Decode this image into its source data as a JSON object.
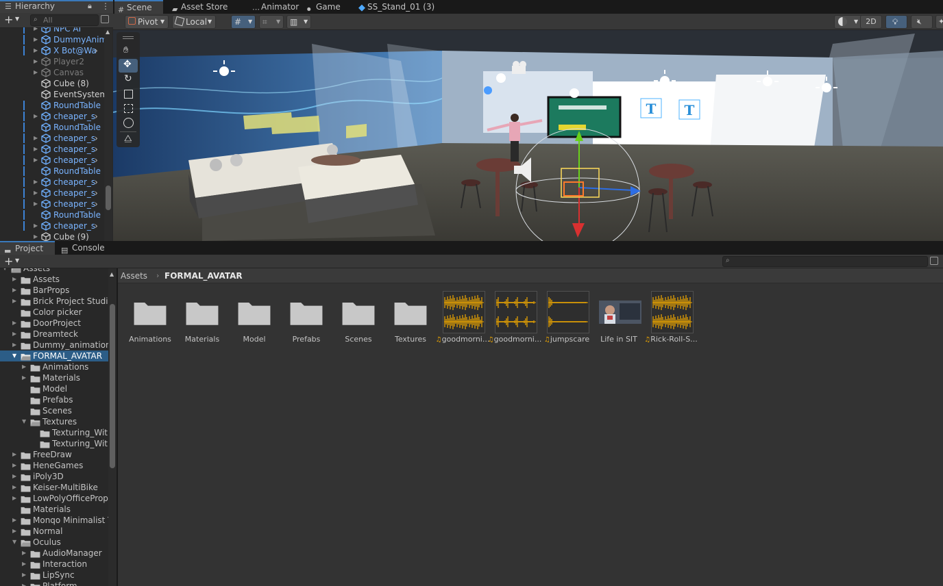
{
  "hierarchy": {
    "tab_label": "Hierarchy",
    "search_placeholder": "All",
    "rows": [
      {
        "name": "NPC AI",
        "color": "blue",
        "arrow": true,
        "more": false,
        "prefab": true
      },
      {
        "name": "DummyAnim",
        "color": "blue",
        "arrow": true,
        "more": false,
        "prefab": true
      },
      {
        "name": "X Bot@Wa",
        "color": "blue",
        "arrow": true,
        "more": true,
        "prefab": true
      },
      {
        "name": "Player2",
        "color": "grey",
        "arrow": true,
        "more": false,
        "prefab": false
      },
      {
        "name": "Canvas",
        "color": "grey",
        "arrow": true,
        "more": false,
        "prefab": false
      },
      {
        "name": "Cube (8)",
        "color": "white",
        "arrow": false,
        "more": false,
        "prefab": false
      },
      {
        "name": "EventSystem",
        "color": "white",
        "arrow": false,
        "more": false,
        "prefab": false
      },
      {
        "name": "RoundTable",
        "color": "blue",
        "arrow": false,
        "more": false,
        "prefab": true
      },
      {
        "name": "cheaper_s",
        "color": "blue",
        "arrow": true,
        "more": true,
        "prefab": true
      },
      {
        "name": "RoundTable",
        "color": "blue",
        "arrow": false,
        "more": false,
        "prefab": true
      },
      {
        "name": "cheaper_s",
        "color": "blue",
        "arrow": true,
        "more": true,
        "prefab": true
      },
      {
        "name": "cheaper_s",
        "color": "blue",
        "arrow": true,
        "more": true,
        "prefab": true
      },
      {
        "name": "cheaper_s",
        "color": "blue",
        "arrow": true,
        "more": true,
        "prefab": true
      },
      {
        "name": "RoundTable",
        "color": "blue",
        "arrow": false,
        "more": false,
        "prefab": true
      },
      {
        "name": "cheaper_s",
        "color": "blue",
        "arrow": true,
        "more": true,
        "prefab": true
      },
      {
        "name": "cheaper_s",
        "color": "blue",
        "arrow": true,
        "more": true,
        "prefab": true
      },
      {
        "name": "cheaper_s",
        "color": "blue",
        "arrow": true,
        "more": true,
        "prefab": true
      },
      {
        "name": "RoundTable",
        "color": "blue",
        "arrow": false,
        "more": false,
        "prefab": true
      },
      {
        "name": "cheaper_s",
        "color": "blue",
        "arrow": true,
        "more": true,
        "prefab": true
      },
      {
        "name": "Cube (9)",
        "color": "white",
        "arrow": true,
        "more": false,
        "prefab": false
      }
    ]
  },
  "top_tabs": [
    {
      "label": "Scene",
      "icon": "grid-icon",
      "active": true
    },
    {
      "label": "Asset Store",
      "icon": "shopping-bag-icon",
      "active": false
    },
    {
      "label": "Animator",
      "icon": "animator-icon",
      "active": false
    },
    {
      "label": "Game",
      "icon": "gamepad-icon",
      "active": false
    },
    {
      "label": "SS_Stand_01 (3)",
      "icon": "prefab-cube-icon",
      "active": false
    }
  ],
  "scene_toolbar": {
    "pivot_label": "Pivot",
    "local_label": "Local",
    "mode_2d_label": "2D"
  },
  "project": {
    "tabs": [
      {
        "label": "Project",
        "icon": "folder-icon",
        "active": true
      },
      {
        "label": "Console",
        "icon": "console-icon",
        "active": false
      }
    ],
    "tree": [
      {
        "name": "Assets",
        "level": 0,
        "expanded": true,
        "arrow": true,
        "selected": false
      },
      {
        "name": "Assets",
        "level": 1,
        "expanded": false,
        "arrow": true,
        "selected": false
      },
      {
        "name": "BarProps",
        "level": 1,
        "expanded": false,
        "arrow": true,
        "selected": false
      },
      {
        "name": "Brick Project Studio",
        "level": 1,
        "expanded": false,
        "arrow": true,
        "selected": false
      },
      {
        "name": "Color picker",
        "level": 1,
        "expanded": false,
        "arrow": false,
        "selected": false
      },
      {
        "name": "DoorProject",
        "level": 1,
        "expanded": false,
        "arrow": true,
        "selected": false
      },
      {
        "name": "Dreamteck",
        "level": 1,
        "expanded": false,
        "arrow": true,
        "selected": false
      },
      {
        "name": "Dummy_animation",
        "level": 1,
        "expanded": false,
        "arrow": true,
        "selected": false
      },
      {
        "name": "FORMAL_AVATAR",
        "level": 1,
        "expanded": true,
        "arrow": true,
        "selected": true
      },
      {
        "name": "Animations",
        "level": 2,
        "expanded": false,
        "arrow": true,
        "selected": false
      },
      {
        "name": "Materials",
        "level": 2,
        "expanded": false,
        "arrow": true,
        "selected": false
      },
      {
        "name": "Model",
        "level": 2,
        "expanded": false,
        "arrow": false,
        "selected": false
      },
      {
        "name": "Prefabs",
        "level": 2,
        "expanded": false,
        "arrow": false,
        "selected": false
      },
      {
        "name": "Scenes",
        "level": 2,
        "expanded": false,
        "arrow": false,
        "selected": false
      },
      {
        "name": "Textures",
        "level": 2,
        "expanded": true,
        "arrow": true,
        "selected": false
      },
      {
        "name": "Texturing_With",
        "level": 3,
        "expanded": false,
        "arrow": false,
        "selected": false
      },
      {
        "name": "Texturing_With",
        "level": 3,
        "expanded": false,
        "arrow": false,
        "selected": false
      },
      {
        "name": "FreeDraw",
        "level": 1,
        "expanded": false,
        "arrow": true,
        "selected": false
      },
      {
        "name": "HeneGames",
        "level": 1,
        "expanded": false,
        "arrow": true,
        "selected": false
      },
      {
        "name": "iPoly3D",
        "level": 1,
        "expanded": false,
        "arrow": true,
        "selected": false
      },
      {
        "name": "Keiser-MultiBike",
        "level": 1,
        "expanded": false,
        "arrow": true,
        "selected": false
      },
      {
        "name": "LowPolyOfficeProp",
        "level": 1,
        "expanded": false,
        "arrow": true,
        "selected": false
      },
      {
        "name": "Materials",
        "level": 1,
        "expanded": false,
        "arrow": false,
        "selected": false
      },
      {
        "name": "Monqo Minimalist T",
        "level": 1,
        "expanded": false,
        "arrow": true,
        "selected": false
      },
      {
        "name": "Normal",
        "level": 1,
        "expanded": false,
        "arrow": true,
        "selected": false
      },
      {
        "name": "Oculus",
        "level": 1,
        "expanded": true,
        "arrow": true,
        "selected": false
      },
      {
        "name": "AudioManager",
        "level": 2,
        "expanded": false,
        "arrow": true,
        "selected": false
      },
      {
        "name": "Interaction",
        "level": 2,
        "expanded": false,
        "arrow": true,
        "selected": false
      },
      {
        "name": "LipSync",
        "level": 2,
        "expanded": false,
        "arrow": true,
        "selected": false
      },
      {
        "name": "Platform",
        "level": 2,
        "expanded": false,
        "arrow": true,
        "selected": false
      }
    ],
    "breadcrumb": [
      "Assets",
      "FORMAL_AVATAR"
    ],
    "assets": [
      {
        "label": "Animations",
        "kind": "folder"
      },
      {
        "label": "Materials",
        "kind": "folder"
      },
      {
        "label": "Model",
        "kind": "folder"
      },
      {
        "label": "Prefabs",
        "kind": "folder"
      },
      {
        "label": "Scenes",
        "kind": "folder"
      },
      {
        "label": "Textures",
        "kind": "folder"
      },
      {
        "label": "goodmorni...",
        "kind": "audio",
        "wave": "dense"
      },
      {
        "label": "goodmorni...",
        "kind": "audio",
        "wave": "sparse"
      },
      {
        "label": "jumpscare",
        "kind": "audio",
        "wave": "spike"
      },
      {
        "label": "Life in SIT",
        "kind": "video"
      },
      {
        "label": "Rick-Roll-S...",
        "kind": "audio",
        "wave": "dense"
      }
    ]
  },
  "colors": {
    "accent": "#3a79bb",
    "selection": "#2c5d87",
    "prefab_text": "#7ab4ff",
    "waveform": "#f0a800"
  }
}
